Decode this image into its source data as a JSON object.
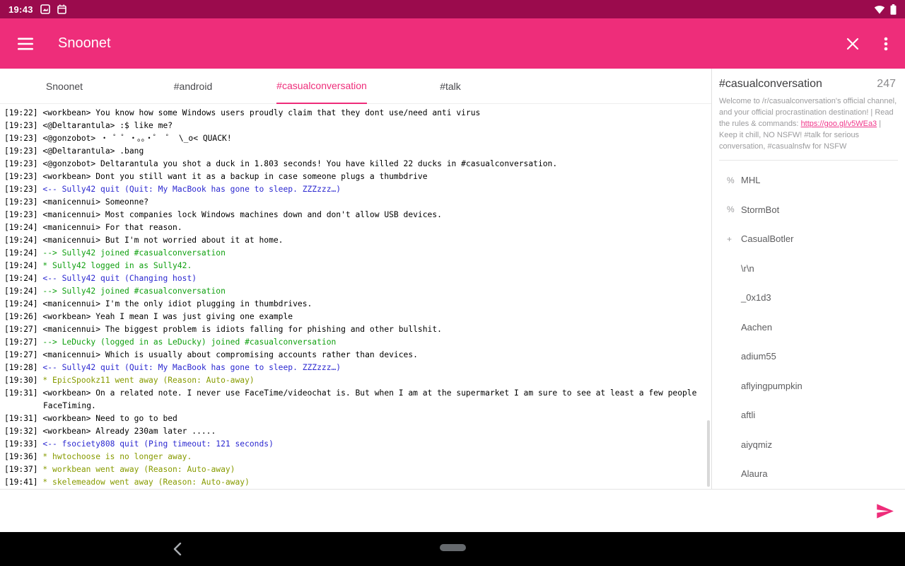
{
  "colors": {
    "status_bar": "#9b0b4d",
    "app_bar": "#ee2d7a",
    "accent": "#ee2d7a",
    "quit": "#2b28d0",
    "join": "#10a010",
    "away": "#879b00",
    "link": "#f0368a"
  },
  "status_bar": {
    "time": "19:43"
  },
  "app_bar": {
    "title": "Snoonet"
  },
  "tabs": [
    {
      "label": "Snoonet",
      "active": false
    },
    {
      "label": "#android",
      "active": false
    },
    {
      "label": "#casualconversation",
      "active": true
    },
    {
      "label": "#talk",
      "active": false
    }
  ],
  "chat": {
    "messages": [
      {
        "time": "[19:22]",
        "text": "<workbean> You know how some Windows users proudly claim that they dont use/need anti virus",
        "type": "normal"
      },
      {
        "time": "[19:23]",
        "text": "<@Deltarantula> :$ like me?",
        "type": "normal"
      },
      {
        "time": "[19:23]",
        "text": "<@gonzobot> ・ ゜゜・。。・゜ ゜ \\_o< QUACK!",
        "type": "normal"
      },
      {
        "time": "[19:23]",
        "text": "<@Deltarantula> .bang",
        "type": "normal"
      },
      {
        "time": "[19:23]",
        "text": "<@gonzobot> Deltarantula you shot a duck in 1.803 seconds! You have killed 22 ducks in #casualconversation.",
        "type": "normal"
      },
      {
        "time": "[19:23]",
        "text": "<workbean> Dont you still want it as a backup in case someone plugs a thumbdrive",
        "type": "normal"
      },
      {
        "time": "[19:23]",
        "text": "<-- Sully42 quit (Quit: My MacBook has gone to sleep. ZZZzzz…)",
        "type": "quit"
      },
      {
        "time": "[19:23]",
        "text": "<manicennui> Someonne?",
        "type": "normal"
      },
      {
        "time": "[19:23]",
        "text": "<manicennui> Most companies lock Windows machines down and don't allow USB devices.",
        "type": "normal"
      },
      {
        "time": "[19:24]",
        "text": "<manicennui> For that reason.",
        "type": "normal"
      },
      {
        "time": "[19:24]",
        "text": "<manicennui> But I'm not worried about it at home.",
        "type": "normal"
      },
      {
        "time": "[19:24]",
        "text": "--> Sully42 joined #casualconversation",
        "type": "join"
      },
      {
        "time": "[19:24]",
        "text": "* Sully42 logged in as Sully42.",
        "type": "join"
      },
      {
        "time": "[19:24]",
        "text": "<-- Sully42 quit (Changing host)",
        "type": "quit"
      },
      {
        "time": "[19:24]",
        "text": "--> Sully42 joined #casualconversation",
        "type": "join"
      },
      {
        "time": "[19:24]",
        "text": "<manicennui> I'm the only idiot plugging in thumbdrives.",
        "type": "normal"
      },
      {
        "time": "[19:26]",
        "text": "<workbean> Yeah I mean I was just giving one example",
        "type": "normal"
      },
      {
        "time": "[19:27]",
        "text": "<manicennui> The biggest problem is idiots falling for phishing and other bullshit.",
        "type": "normal"
      },
      {
        "time": "[19:27]",
        "text": "--> LeDucky (logged in as LeDucky) joined #casualconversation",
        "type": "join"
      },
      {
        "time": "[19:27]",
        "text": "<manicennui> Which is usually about compromising accounts rather than devices.",
        "type": "normal"
      },
      {
        "time": "[19:28]",
        "text": "<-- Sully42 quit (Quit: My MacBook has gone to sleep. ZZZzzz…)",
        "type": "quit"
      },
      {
        "time": "[19:30]",
        "text": "* EpicSpookz11 went away (Reason: Auto-away)",
        "type": "away"
      },
      {
        "time": "[19:31]",
        "text": "<workbean> On a related note. I never use FaceTime/videochat is. But when I am at the supermarket I am sure to see at least a few people FaceTiming.",
        "type": "normal"
      },
      {
        "time": "[19:31]",
        "text": "<workbean> Need to go to bed",
        "type": "normal"
      },
      {
        "time": "[19:32]",
        "text": "<workbean> Already 230am later .....",
        "type": "normal"
      },
      {
        "time": "[19:33]",
        "text": "<-- fsociety808 quit (Ping timeout: 121 seconds)",
        "type": "quit"
      },
      {
        "time": "[19:36]",
        "text": "* hwtochoose is no longer away.",
        "type": "away"
      },
      {
        "time": "[19:37]",
        "text": "* workbean went away (Reason: Auto-away)",
        "type": "away"
      },
      {
        "time": "[19:41]",
        "text": "* skelemeadow went away (Reason: Auto-away)",
        "type": "away"
      }
    ]
  },
  "sidebar": {
    "channel": "#casualconversation",
    "user_count": "247",
    "topic": {
      "pre": "Welcome to /r/casualconversation's official channel, and your official procrastination destination! | Read the rules & commands: ",
      "link": "https://goo.gl/v5WEa3",
      "post": " | Keep it chill, NO NSFW! #talk for serious conversation, #casualnsfw for NSFW"
    },
    "users": [
      {
        "prefix": "%",
        "name": "MHL"
      },
      {
        "prefix": "%",
        "name": "StormBot"
      },
      {
        "prefix": "+",
        "name": "CasualBotler"
      },
      {
        "prefix": "",
        "name": "\\r\\n"
      },
      {
        "prefix": "",
        "name": "_0x1d3"
      },
      {
        "prefix": "",
        "name": "Aachen"
      },
      {
        "prefix": "",
        "name": "adium55"
      },
      {
        "prefix": "",
        "name": "aflyingpumpkin"
      },
      {
        "prefix": "",
        "name": "aftli"
      },
      {
        "prefix": "",
        "name": "aiyqmiz"
      },
      {
        "prefix": "",
        "name": "Alaura"
      }
    ]
  }
}
